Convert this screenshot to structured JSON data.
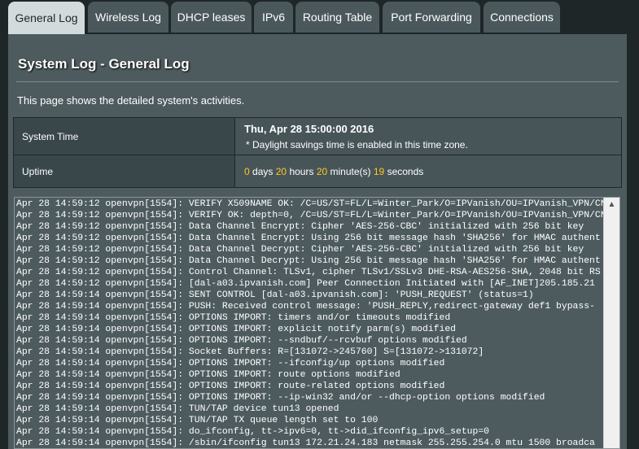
{
  "tabs": [
    {
      "label": "General Log",
      "active": true
    },
    {
      "label": "Wireless Log"
    },
    {
      "label": "DHCP leases"
    },
    {
      "label": "IPv6"
    },
    {
      "label": "Routing Table"
    },
    {
      "label": "Port Forwarding"
    },
    {
      "label": "Connections"
    }
  ],
  "page": {
    "title": "System Log - General Log",
    "description": "This page shows the detailed system's activities."
  },
  "system_time": {
    "label": "System Time",
    "value": "Thu, Apr 28 15:00:00 2016",
    "note": "* Daylight savings time is enabled in this time zone."
  },
  "uptime": {
    "label": "Uptime",
    "days": "0",
    "days_unit": "days",
    "hours": "20",
    "hours_unit": "hours",
    "minutes": "20",
    "minutes_unit": "minute(s)",
    "seconds": "19",
    "seconds_unit": "seconds"
  },
  "log": {
    "text": "Apr 28 14:59:12 openvpn[1554]: VERIFY X509NAME OK: /C=US/ST=FL/L=Winter_Park/O=IPVanish/OU=IPVanish_VPN/CN=\nApr 28 14:59:12 openvpn[1554]: VERIFY OK: depth=0, /C=US/ST=FL/L=Winter_Park/O=IPVanish/OU=IPVanish_VPN/CN=\nApr 28 14:59:12 openvpn[1554]: Data Channel Encrypt: Cipher 'AES-256-CBC' initialized with 256 bit key\nApr 28 14:59:12 openvpn[1554]: Data Channel Encrypt: Using 256 bit message hash 'SHA256' for HMAC authent\nApr 28 14:59:12 openvpn[1554]: Data Channel Decrypt: Cipher 'AES-256-CBC' initialized with 256 bit key\nApr 28 14:59:12 openvpn[1554]: Data Channel Decrypt: Using 256 bit message hash 'SHA256' for HMAC authent\nApr 28 14:59:12 openvpn[1554]: Control Channel: TLSv1, cipher TLSv1/SSLv3 DHE-RSA-AES256-SHA, 2048 bit RS\nApr 28 14:59:12 openvpn[1554]: [dal-a03.ipvanish.com] Peer Connection Initiated with [AF_INET]205.185.21\nApr 28 14:59:14 openvpn[1554]: SENT CONTROL [dal-a03.ipvanish.com]: 'PUSH_REQUEST' (status=1)\nApr 28 14:59:14 openvpn[1554]: PUSH: Received control message: 'PUSH_REPLY,redirect-gateway def1 bypass-\nApr 28 14:59:14 openvpn[1554]: OPTIONS IMPORT: timers and/or timeouts modified\nApr 28 14:59:14 openvpn[1554]: OPTIONS IMPORT: explicit notify parm(s) modified\nApr 28 14:59:14 openvpn[1554]: OPTIONS IMPORT: --sndbuf/--rcvbuf options modified\nApr 28 14:59:14 openvpn[1554]: Socket Buffers: R=[131072->245760] S=[131072->131072]\nApr 28 14:59:14 openvpn[1554]: OPTIONS IMPORT: --ifconfig/up options modified\nApr 28 14:59:14 openvpn[1554]: OPTIONS IMPORT: route options modified\nApr 28 14:59:14 openvpn[1554]: OPTIONS IMPORT: route-related options modified\nApr 28 14:59:14 openvpn[1554]: OPTIONS IMPORT: --ip-win32 and/or --dhcp-option options modified\nApr 28 14:59:14 openvpn[1554]: TUN/TAP device tun13 opened\nApr 28 14:59:14 openvpn[1554]: TUN/TAP TX queue length set to 100\nApr 28 14:59:14 openvpn[1554]: do_ifconfig, tt->ipv6=0, tt->did_ifconfig_ipv6_setup=0\nApr 28 14:59:14 openvpn[1554]: /sbin/ifconfig tun13 172.21.24.183 netmask 255.255.254.0 mtu 1500 broadca"
  },
  "colors": {
    "accent_number": "#ffc824",
    "active_tab": "#d2dadc",
    "panel": "#4d5b5f"
  },
  "icons": {
    "scroll_up": "chevron-up-icon"
  }
}
